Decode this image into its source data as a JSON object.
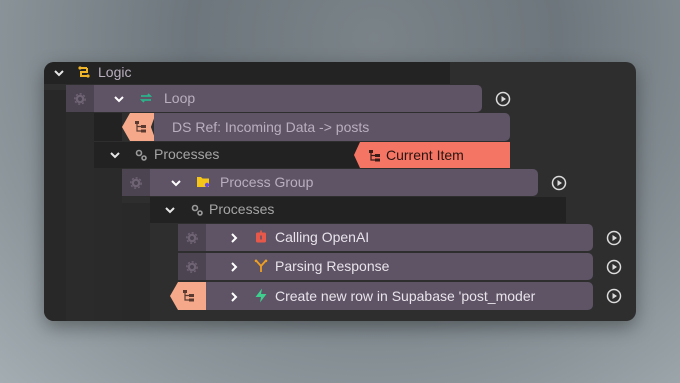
{
  "tree": {
    "logic_label": "Logic",
    "loop_label": "Loop",
    "ds_ref_label": "DS Ref: Incoming Data -> posts",
    "processes_label_1": "Processes",
    "current_item_label": "Current Item",
    "process_group_label": "Process Group",
    "processes_label_2": "Processes",
    "items": [
      {
        "label": "Calling OpenAI"
      },
      {
        "label": "Parsing Response"
      },
      {
        "label": "Create new row in Supabase 'post_moder"
      }
    ]
  },
  "colors": {
    "accent_salmon": "#f47563",
    "ref_peach": "#f5a98a",
    "row_purple": "#5f5366",
    "logic_icon": "#f0b429",
    "loop_icon": "#2bb38a",
    "folder_icon": "#f5c518",
    "openai_icon": "#e8584a",
    "parse_icon": "#f0a020",
    "supabase_icon": "#3ecf8e"
  },
  "icons": [
    "chevron-down-icon",
    "chevron-right-icon",
    "logic-icon",
    "loop-icon",
    "gear-icon",
    "hierarchy-icon",
    "processes-icon",
    "folder-icon",
    "play-icon",
    "openai-icon",
    "parse-icon",
    "supabase-icon"
  ]
}
